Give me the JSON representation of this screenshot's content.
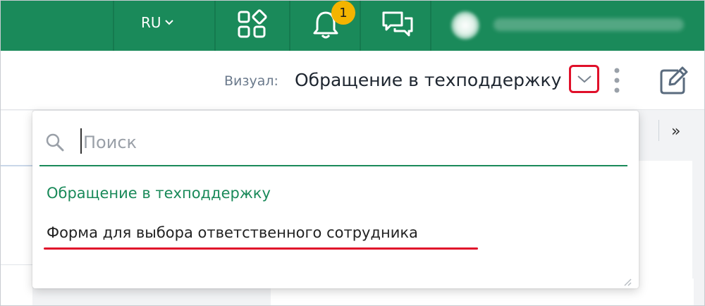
{
  "header": {
    "language": "RU",
    "notifications_count": "1",
    "icons": [
      "apps-icon",
      "bell-icon",
      "chat-icon",
      "chevron-down-icon"
    ],
    "colors": {
      "header_bg": "#1a8a5a",
      "badge": "#f4b400"
    }
  },
  "toolbar": {
    "visual_label": "Визуал:",
    "visual_value": "Обращение в техподдержку",
    "icons": [
      "chevron-down-icon",
      "kebab-menu-icon",
      "edit-icon"
    ],
    "highlight_color": "#e0102a"
  },
  "dropdown": {
    "search_placeholder": "Поиск",
    "options": [
      {
        "label": "Обращение в техподдержку",
        "selected": true
      },
      {
        "label": "Форма для выбора ответственного сотрудника",
        "selected": false
      }
    ],
    "colors": {
      "accent": "#1a8a5a",
      "annotation": "#e0102a"
    }
  },
  "side": {
    "collapse_label": "»"
  }
}
